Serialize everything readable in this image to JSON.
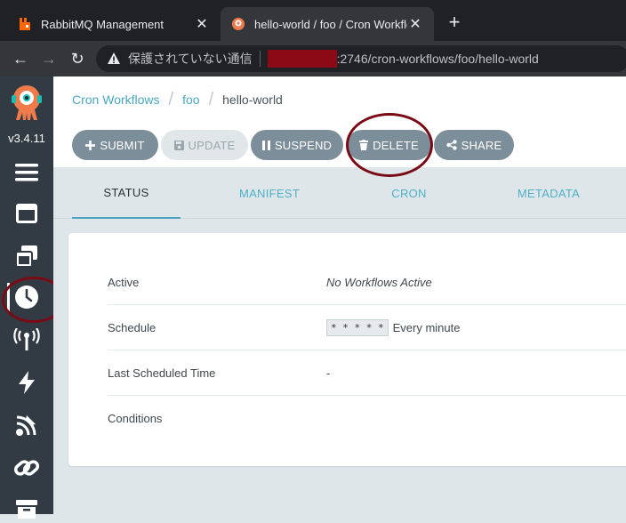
{
  "browser": {
    "tabs": [
      {
        "title": "RabbitMQ Management",
        "favicon": "rabbitmq-icon",
        "active": false
      },
      {
        "title": "hello-world / foo / Cron Workflows",
        "favicon": "argo-icon",
        "active": true
      }
    ],
    "new_tab_label": "+",
    "security_text": "保護されていない通信",
    "url": ":2746/cron-workflows/foo/hello-world"
  },
  "sidebar": {
    "version": "v3.4.11",
    "items": [
      {
        "icon": "menu-icon"
      },
      {
        "icon": "workflows-icon"
      },
      {
        "icon": "workflow-templates-icon"
      },
      {
        "icon": "clock-icon",
        "active": true
      },
      {
        "icon": "event-sources-icon"
      },
      {
        "icon": "sensors-icon"
      },
      {
        "icon": "event-flow-icon"
      },
      {
        "icon": "link-icon"
      },
      {
        "icon": "archive-icon"
      }
    ]
  },
  "breadcrumb": {
    "items": [
      "Cron Workflows",
      "foo"
    ],
    "current": "hello-world"
  },
  "toolbar": {
    "submit": "SUBMIT",
    "update": "UPDATE",
    "suspend": "SUSPEND",
    "delete": "DELETE",
    "share": "SHARE"
  },
  "tabs": {
    "status": "STATUS",
    "manifest": "MANIFEST",
    "cron": "CRON",
    "metadata": "METADATA",
    "active_tab": "STATUS"
  },
  "details": {
    "rows": [
      {
        "label": "Active",
        "value": "No Workflows Active"
      },
      {
        "label": "Schedule",
        "cron": "* * * * *",
        "value": "Every minute"
      },
      {
        "label": "Last Scheduled Time",
        "value": "-"
      },
      {
        "label": "Conditions",
        "value": ""
      }
    ]
  },
  "colors": {
    "sidebar": "#323b44",
    "button": "#7c8e99",
    "link": "#4aa6c0",
    "annotation": "#7a0a14"
  }
}
